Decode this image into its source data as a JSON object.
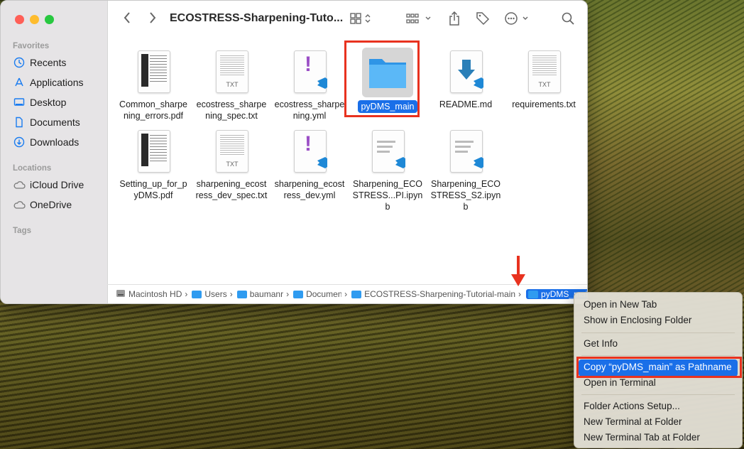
{
  "window_title": "ECOSTRESS-Sharpening-Tuto...",
  "sidebar": {
    "favorites_header": "Favorites",
    "favorites": [
      "Recents",
      "Applications",
      "Desktop",
      "Documents",
      "Downloads"
    ],
    "locations_header": "Locations",
    "locations": [
      "iCloud Drive",
      "OneDrive"
    ],
    "tags_header": "Tags"
  },
  "files": [
    {
      "name": "Common_sharpe ning_errors.pdf",
      "type": "pdf"
    },
    {
      "name": "ecostress_sharpe ning_spec.txt",
      "type": "txt"
    },
    {
      "name": "ecostress_sharpe ning.yml",
      "type": "yml"
    },
    {
      "name": "pyDMS_main",
      "type": "folder",
      "selected": true
    },
    {
      "name": "README.md",
      "type": "md"
    },
    {
      "name": "requirements.txt",
      "type": "txt"
    },
    {
      "name": "Setting_up_for_p yDMS.pdf",
      "type": "pdf"
    },
    {
      "name": "sharpening_ecost ress_dev_spec.txt",
      "type": "txt"
    },
    {
      "name": "sharpening_ecost ress_dev.yml",
      "type": "yml"
    },
    {
      "name": "Sharpening_ECO STRESS...PI.ipynb",
      "type": "ipynb"
    },
    {
      "name": "Sharpening_ECO STRESS_S2.ipynb",
      "type": "ipynb"
    }
  ],
  "txt_label": "TXT",
  "pathbar": [
    "Macintosh HD",
    "Users",
    "baumanr",
    "Documents",
    "ECOSTRESS-Sharpening-Tutorial-main",
    "pyDMS_main"
  ],
  "context_menu": {
    "items": [
      "Open in New Tab",
      "Show in Enclosing Folder",
      "Get Info",
      "Copy “pyDMS_main” as Pathname",
      "Open in Terminal",
      "Folder Actions Setup...",
      "New Terminal at Folder",
      "New Terminal Tab at Folder"
    ]
  },
  "colors": {
    "accent": "#1a6fe8",
    "highlight_box": "#e8321f",
    "folder": "#3aa2f3"
  }
}
